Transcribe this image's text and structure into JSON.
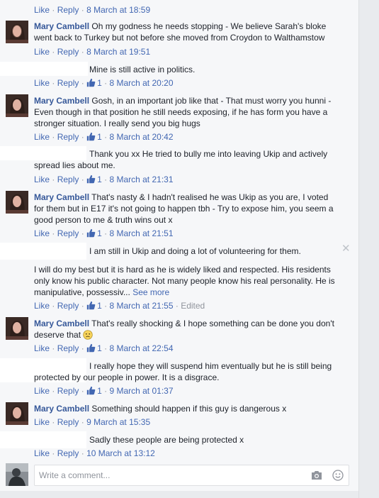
{
  "actions": {
    "like": "Like",
    "reply": "Reply",
    "sep": "·"
  },
  "comments": [
    {
      "author": "",
      "lines": [],
      "likes": "",
      "time": "8 March at 18:59",
      "edited": ""
    },
    {
      "author": "Mary Cambell",
      "lines": [
        "Oh my godness he needs stopping - We believe Sarah's bloke",
        "went back to Turkey but not before she moved from Croydon to Walthamstow"
      ],
      "likes": "",
      "time": "8 March at 19:51",
      "edited": ""
    },
    {
      "author": "",
      "lines": [
        "Mine is still active in politics."
      ],
      "likes": "1",
      "time": "8 March at 20:20",
      "edited": ""
    },
    {
      "author": "Mary Cambell",
      "lines": [
        "Gosh, in an important job like that - That must worry you hunni -",
        "Even though in that position he still needs exposing, if he has form you have a",
        "stronger situation. I really send you big hugs"
      ],
      "likes": "1",
      "time": "8 March at 20:42",
      "edited": ""
    },
    {
      "author": "",
      "lines": [
        "Thank you xx He tried to bully me into leaving Ukip and actively",
        "spread lies about me."
      ],
      "likes": "1",
      "time": "8 March at 21:31",
      "edited": ""
    },
    {
      "author": "Mary Cambell",
      "lines": [
        "That's nasty & I hadn't realised he was Ukip as you are, I voted",
        "for them but in E17 it's not going to happen tbh - Try to expose him, you seem a",
        "good person to me & truth wins out x"
      ],
      "likes": "1",
      "time": "8 March at 21:51",
      "edited": ""
    },
    {
      "author": "",
      "lines": [
        "I am still in Ukip and doing a lot of volunteering for them.",
        "I will do my best but it is hard as he is widely liked and respected. His residents",
        "only know his public character. Not many people know his real personality. He is",
        "manipulative, possessiv..."
      ],
      "see_more": "See more",
      "likes": "1",
      "time": "8 March at 21:55",
      "edited": "Edited"
    },
    {
      "author": "Mary Cambell",
      "lines": [
        "That's really shocking & I hope something can be done you don't",
        "deserve that"
      ],
      "likes": "1",
      "time": "8 March at 22:54",
      "edited": ""
    },
    {
      "author": "",
      "lines": [
        "I really hope they will suspend him eventually but he is still being",
        "protected by our people in power. It is a disgrace."
      ],
      "likes": "1",
      "time": "9 March at 01:37",
      "edited": ""
    },
    {
      "author": "Mary Cambell",
      "lines": [
        "Something should happen if this guy is dangerous x"
      ],
      "likes": "",
      "time": "9 March at 15:35",
      "edited": ""
    },
    {
      "author": "",
      "lines": [
        "Sadly these people are being protected x"
      ],
      "likes": "",
      "time": "10 March at 13:12",
      "edited": ""
    }
  ],
  "composer": {
    "placeholder": "Write a comment..."
  },
  "icons": {
    "like": "thumbs-up-icon",
    "camera": "camera-icon",
    "emoji": "emoji-icon",
    "frown": "frown-emoji-icon",
    "close": "close-icon"
  },
  "colors": {
    "link": "#4267b2",
    "author": "#365899",
    "meta": "#90949c",
    "background": "#f6f7f9"
  }
}
